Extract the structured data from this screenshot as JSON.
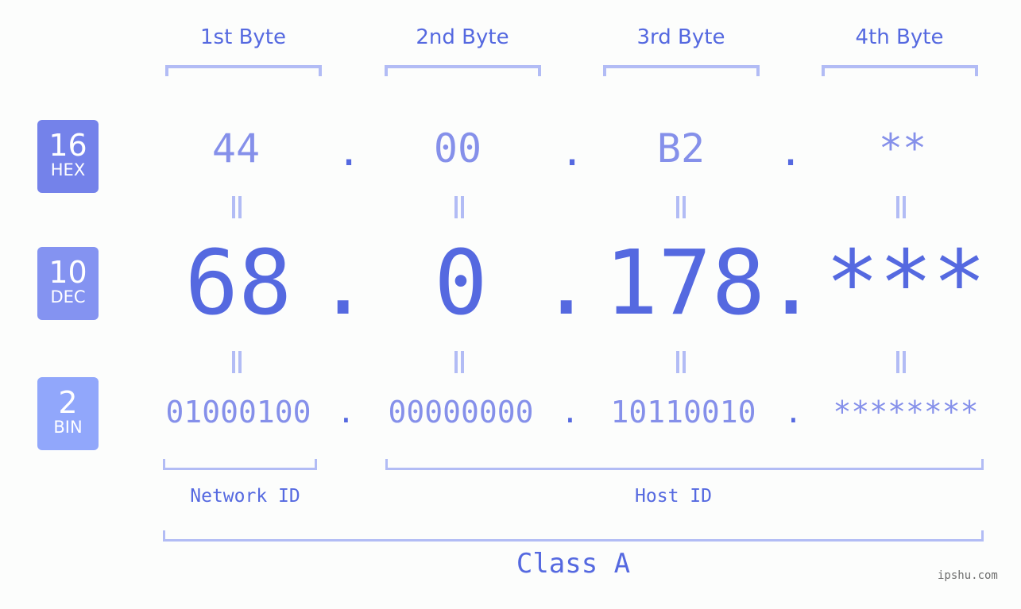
{
  "byte_headers": [
    "1st Byte",
    "2nd Byte",
    "3rd Byte",
    "4th Byte"
  ],
  "badges": [
    {
      "number": "16",
      "label": "HEX",
      "color": "#7482ea"
    },
    {
      "number": "10",
      "label": "DEC",
      "color": "#8493f1"
    },
    {
      "number": "2",
      "label": "BIN",
      "color": "#91a7fb"
    }
  ],
  "hex": [
    "44",
    "00",
    "B2",
    "**"
  ],
  "dec": [
    "68",
    "0",
    "178",
    "***"
  ],
  "bin": [
    "01000100",
    "00000000",
    "10110010",
    "********"
  ],
  "separator": ".",
  "network_id_label": "Network ID",
  "host_id_label": "Host ID",
  "class_label": "Class A",
  "watermark": "ipshu.com",
  "colors": {
    "accent": "#5569e0",
    "light_accent": "#8590ea",
    "bracket": "#b2bcf5",
    "background": "#fcfdfc"
  }
}
